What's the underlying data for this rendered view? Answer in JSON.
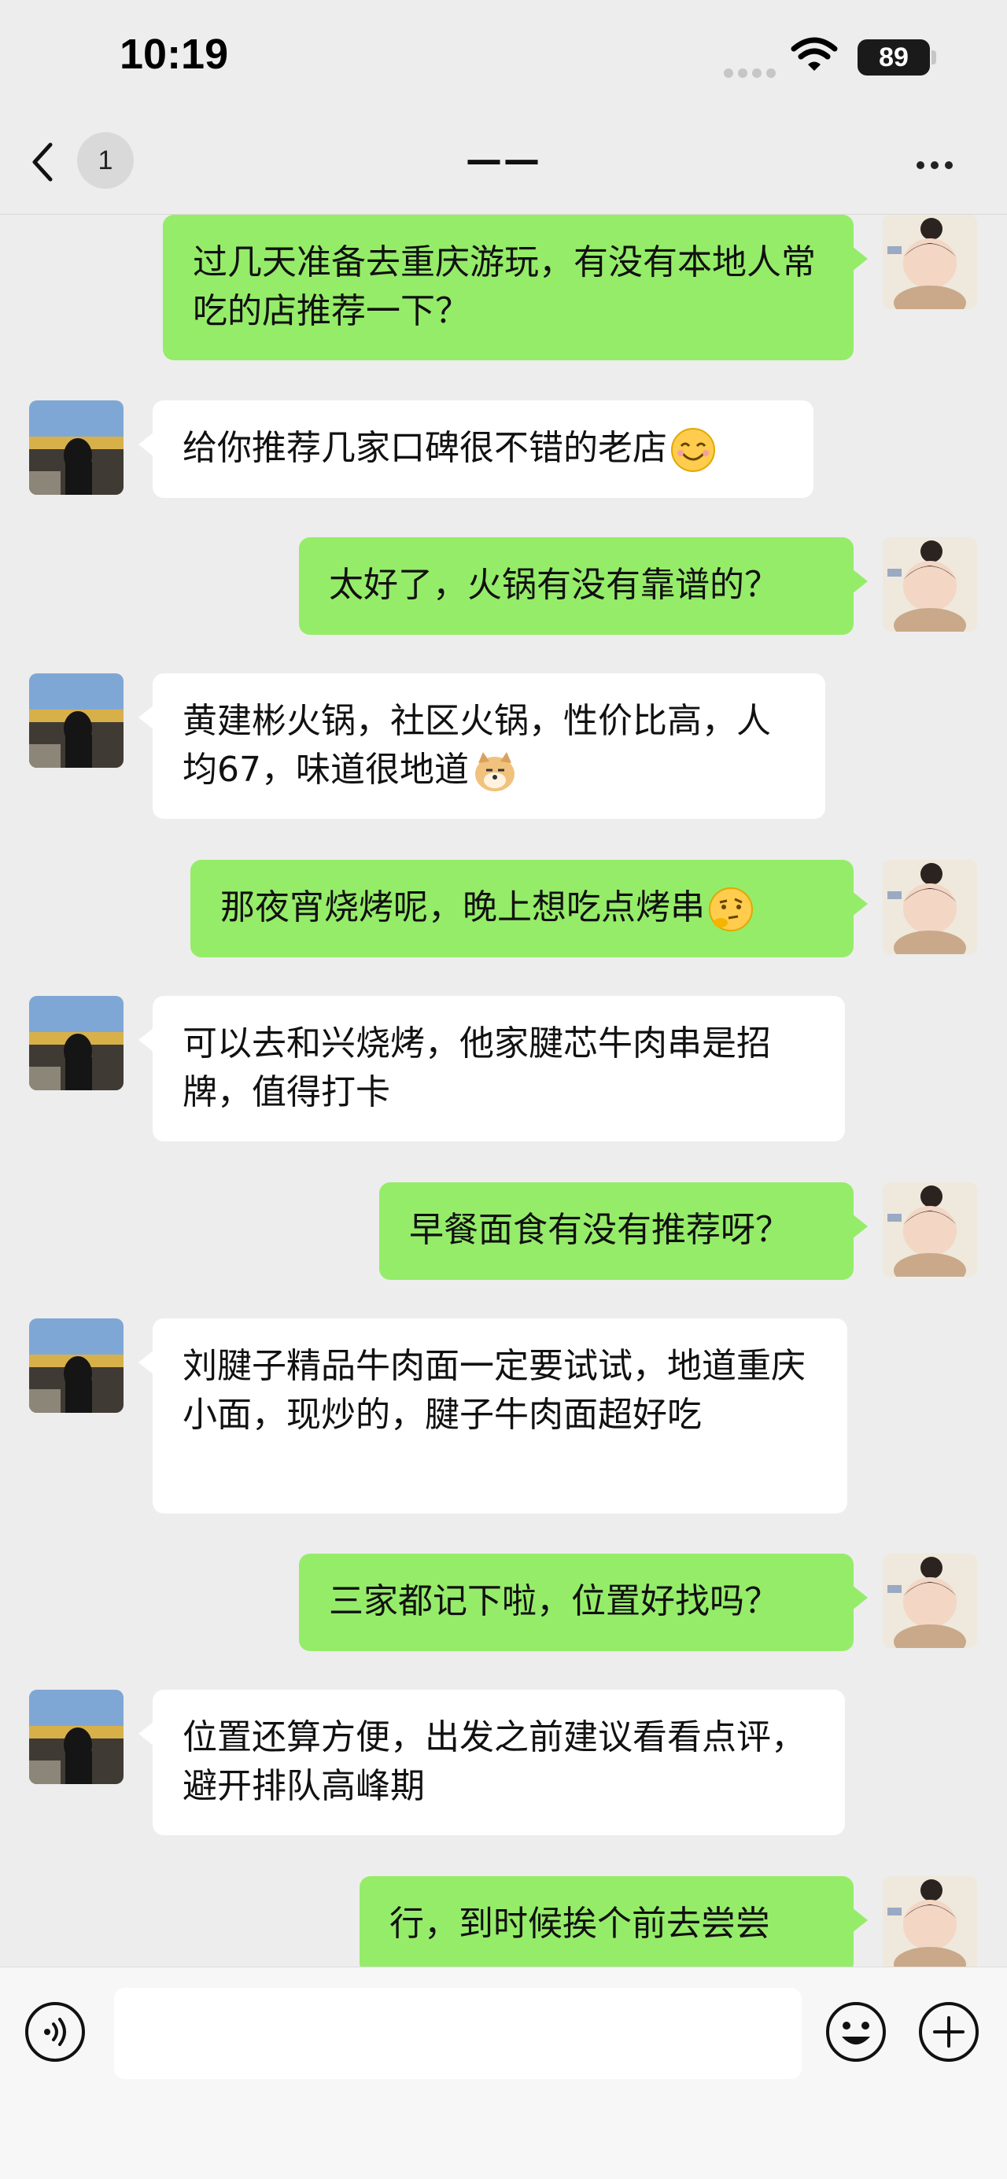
{
  "status_bar": {
    "time": "10:19",
    "battery": "89"
  },
  "nav": {
    "unread_count": "1",
    "title": "——"
  },
  "messages": [
    {
      "side": "out",
      "text": "过几天准备去重庆游玩，有没有本地人常吃的店推荐一下？"
    },
    {
      "side": "in",
      "text": "给你推荐几家口碑很不错的老店",
      "emoji": "smile-emoji"
    },
    {
      "side": "out",
      "text": "太好了，火锅有没有靠谱的？"
    },
    {
      "side": "in",
      "text": "黄建彬火锅，社区火锅，性价比高，人均67，味道很地道",
      "emoji": "doge-emoji"
    },
    {
      "side": "out",
      "text": "那夜宵烧烤呢，晚上想吃点烤串",
      "emoji": "thinking-emoji"
    },
    {
      "side": "in",
      "text": "可以去和兴烧烤，他家腱芯牛肉串是招牌，值得打卡"
    },
    {
      "side": "out",
      "text": "早餐面食有没有推荐呀？"
    },
    {
      "side": "in",
      "text": "刘腱子精品牛肉面一定要试试，地道重庆小面，现炒的，腱子牛肉面超好吃"
    },
    {
      "side": "out",
      "text": "三家都记下啦，位置好找吗？"
    },
    {
      "side": "in",
      "text": "位置还算方便，出发之前建议看看点评，避开排队高峰期"
    },
    {
      "side": "out",
      "text": "行，到时候挨个前去尝尝"
    }
  ],
  "input": {
    "value": "",
    "placeholder": ""
  },
  "icons": {
    "voice": "voice-icon",
    "emoji": "emoji-icon",
    "plus": "plus-icon",
    "back": "chevron-left-icon",
    "more": "more-icon"
  },
  "colors": {
    "outgoing_bubble": "#95ec69",
    "incoming_bubble": "#ffffff",
    "background": "#ededed"
  }
}
